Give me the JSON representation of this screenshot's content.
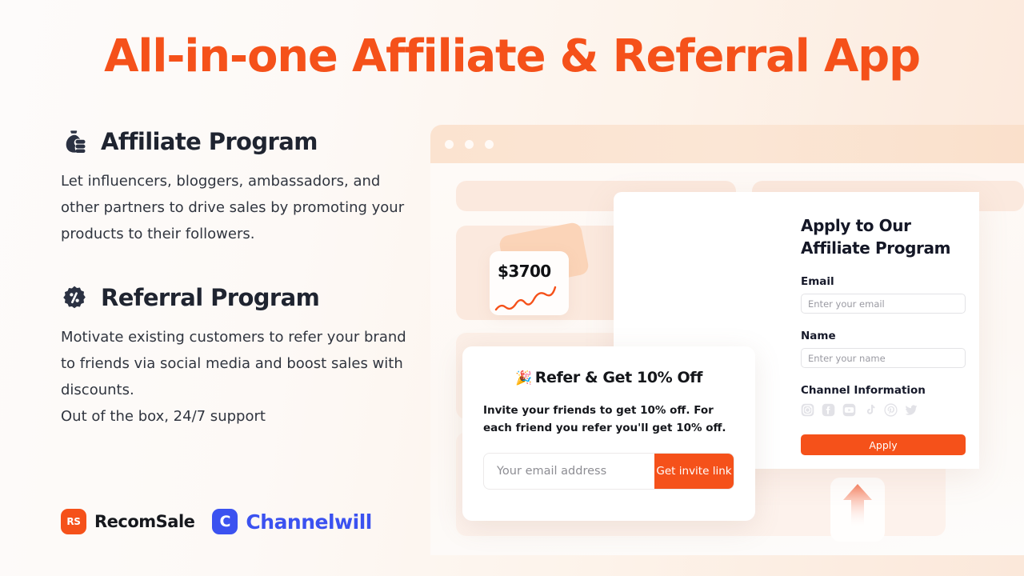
{
  "hero": {
    "title": "All-in-one Affiliate & Referral App"
  },
  "colors": {
    "brand_orange": "#F5511A",
    "dark_navy": "#1f2430",
    "channelwill_blue": "#3B52F0",
    "peach_bar": "#FBE3D0",
    "skeleton_peach": "#FBE9DE"
  },
  "features": [
    {
      "icon": "money-bag-icon",
      "title": "Affiliate Program",
      "body": "Let influencers, bloggers, ambassadors, and other partners to drive sales by promoting your products to their followers."
    },
    {
      "icon": "percent-badge-icon",
      "title": "Referral Program",
      "body": "Motivate existing customers to refer your brand to friends via social media and boost sales with discounts.\nOut of the box, 24/7 support"
    }
  ],
  "logos": [
    {
      "mark": "RS",
      "name": "RecomSale"
    },
    {
      "mark": "C",
      "name": "Channelwill"
    }
  ],
  "browser": {
    "window_dots": 3
  },
  "stat_card": {
    "value": "$3700",
    "sparkline": "orange-trend-line"
  },
  "apply_panel": {
    "title": "Apply to Our Affiliate Program",
    "email_label": "Email",
    "email_placeholder": "Enter your email",
    "name_label": "Name",
    "name_placeholder": "Enter your name",
    "channel_label": "Channel Information",
    "social_icons": [
      "instagram-icon",
      "facebook-icon",
      "youtube-icon",
      "tiktok-icon",
      "pinterest-icon",
      "twitter-icon"
    ],
    "apply_button": "Apply"
  },
  "refer_popup": {
    "emoji": "🎉",
    "title": "Refer & Get 10% Off",
    "body": "Invite your friends to get 10% off. For each friend you refer you'll get 10% off.",
    "email_placeholder": "Your email address",
    "button": "Get invite link"
  }
}
